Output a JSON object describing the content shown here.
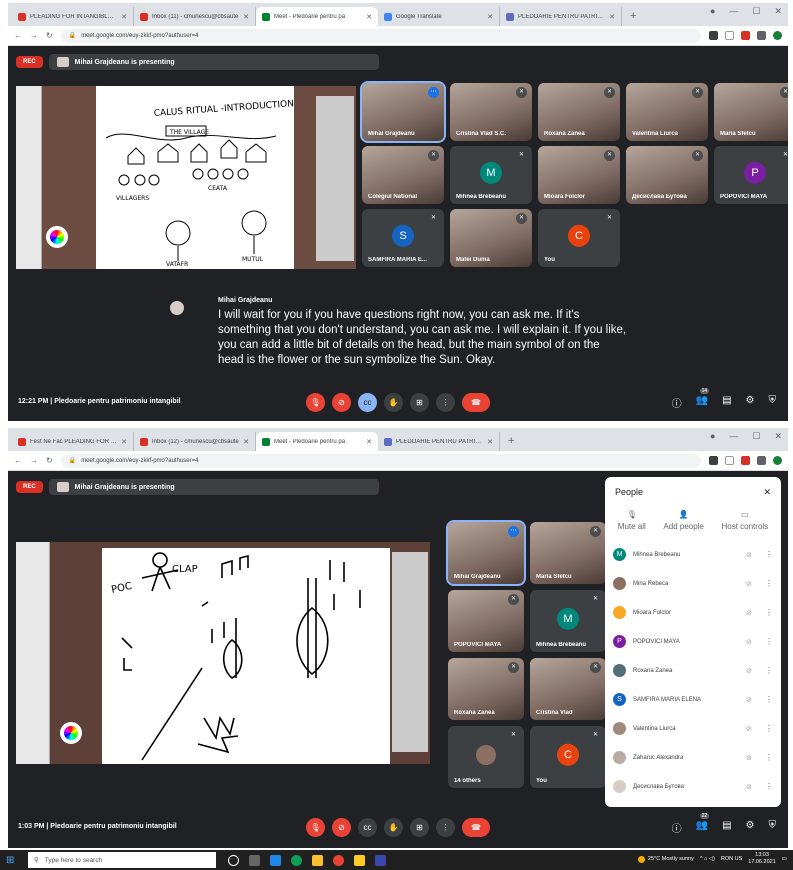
{
  "top": {
    "tabs": [
      {
        "label": "PLEADING FOR INTANGIBLE HE",
        "color": "#d93025"
      },
      {
        "label": "Inbox (11) - cmunescu@cbsaute",
        "color": "#d93025"
      },
      {
        "label": "Meet - Pledoarie pentru pa",
        "color": "#00832d",
        "active": true
      },
      {
        "label": "Google Translate",
        "color": "#4285f4"
      },
      {
        "label": "PLEDOARIE PENTRU PATRIMONIU",
        "color": "#5c6bc0"
      }
    ],
    "new_tab": "+",
    "url": "meet.google.com/euy-zkkf-pmo?authuser=4",
    "rec": "REC",
    "presenting": "Mihai Grajdeanu is presenting",
    "sketch": {
      "title": "CALUS RITUAL -INTRODUCTION",
      "village": "THE VILLAGE",
      "villagers": "VILLAGERS",
      "ceata": "CEATA",
      "vataf": "VATAFR",
      "mutul": "MUTUL"
    },
    "tiles": [
      {
        "name": "Mihai Grajdeanu"
      },
      {
        "name": "Cristina Vlad S.C."
      },
      {
        "name": "Roxana Zanea"
      },
      {
        "name": "Valentina Liurca"
      },
      {
        "name": "Maria Sfetcu"
      },
      {
        "name": "Colegiul National"
      },
      {
        "name": "Mihnea Brebeanu",
        "letter": "M",
        "color": "#00897b"
      },
      {
        "name": "Mioara Folclor"
      },
      {
        "name": "Десислава Бутова"
      },
      {
        "name": "POPOVICI MAYA",
        "letter": "P",
        "color": "#7b1fa2"
      },
      {
        "name": "SAMFIRA MARIA E...",
        "letter": "S",
        "color": "#1565c0"
      },
      {
        "name": "Matei Duma"
      },
      {
        "name": "You",
        "letter": "C",
        "color": "#e8430e"
      }
    ],
    "caption_name": "Mihai Grajdeanu",
    "caption_text": "I will wait for you if you have questions right now, you can ask me. If it's something that you don't understand, you can ask me. I will explain it. If you like, you can add a little bit of details on the head, but the main symbol of on the head is the flower or the sun symbolize the Sun. Okay.",
    "clock": "12:21 PM  |  Pledoarie pentru patrimoniu intangibil",
    "participants_count": "14"
  },
  "bottom": {
    "tabs": [
      {
        "label": "Fest Ne Fac PLEADING FOR INT",
        "color": "#d93025"
      },
      {
        "label": "Inbox (12) - cmunescu@cbsaute",
        "color": "#d93025"
      },
      {
        "label": "Meet - Pledoarie pentru pa",
        "color": "#00832d",
        "active": true
      },
      {
        "label": "PLEDOARIE PENTRU PATRIMONIU",
        "color": "#5c6bc0"
      }
    ],
    "new_tab": "+",
    "url": "meet.google.com/euy-zkkf-pmo?authuser=4",
    "rec": "REC",
    "presenting": "Mihai Grajdeanu is presenting",
    "sketch": {
      "poc": "POC",
      "clap": "CLAP"
    },
    "tiles": [
      {
        "name": "Mihai Grajdeanu"
      },
      {
        "name": "Maria Sfetcu"
      },
      {
        "name": "POPOVICI MAYA"
      },
      {
        "name": "Mihnea Brebeanu",
        "letter": "M",
        "color": "#00897b"
      },
      {
        "name": "Roxana Zanea"
      },
      {
        "name": "Cristina Vlad"
      },
      {
        "name": "14 others"
      },
      {
        "name": "You",
        "letter": "C",
        "color": "#e8430e"
      }
    ],
    "people": {
      "title": "People",
      "close": "✕",
      "actions": [
        {
          "icon": "🎙",
          "label": "Mute all"
        },
        {
          "icon": "👤",
          "label": "Add people"
        },
        {
          "icon": "▭",
          "label": "Host controls"
        }
      ],
      "list": [
        {
          "name": "Mihnea Brebeanu",
          "letter": "M",
          "color": "#00897b"
        },
        {
          "name": "Mina Rebeca",
          "letter": "",
          "color": "#8d6e63"
        },
        {
          "name": "Mioara Folclor",
          "letter": "",
          "color": "#f9a825"
        },
        {
          "name": "POPOVICI MAYA",
          "letter": "P",
          "color": "#7b1fa2"
        },
        {
          "name": "Roxana Zanea",
          "letter": "",
          "color": "#546e7a"
        },
        {
          "name": "SAMFIRA MARIA ELENA",
          "letter": "S",
          "color": "#1565c0"
        },
        {
          "name": "Valentina Liurca",
          "letter": "",
          "color": "#a1887f"
        },
        {
          "name": "Zaharuc Alexandra",
          "letter": "",
          "color": "#bcaaa4"
        },
        {
          "name": "Десислава Бутова",
          "letter": "",
          "color": "#d7ccc8"
        }
      ]
    },
    "clock": "1:03 PM  |  Pledoarie pentru patrimoniu intangibil",
    "participants_count": "22"
  },
  "taskbar": {
    "search_placeholder": "Type here to search",
    "weather": "25°C  Mostly sunny",
    "lang": "RON US",
    "time": "13:03",
    "date": "17.06.2021"
  }
}
